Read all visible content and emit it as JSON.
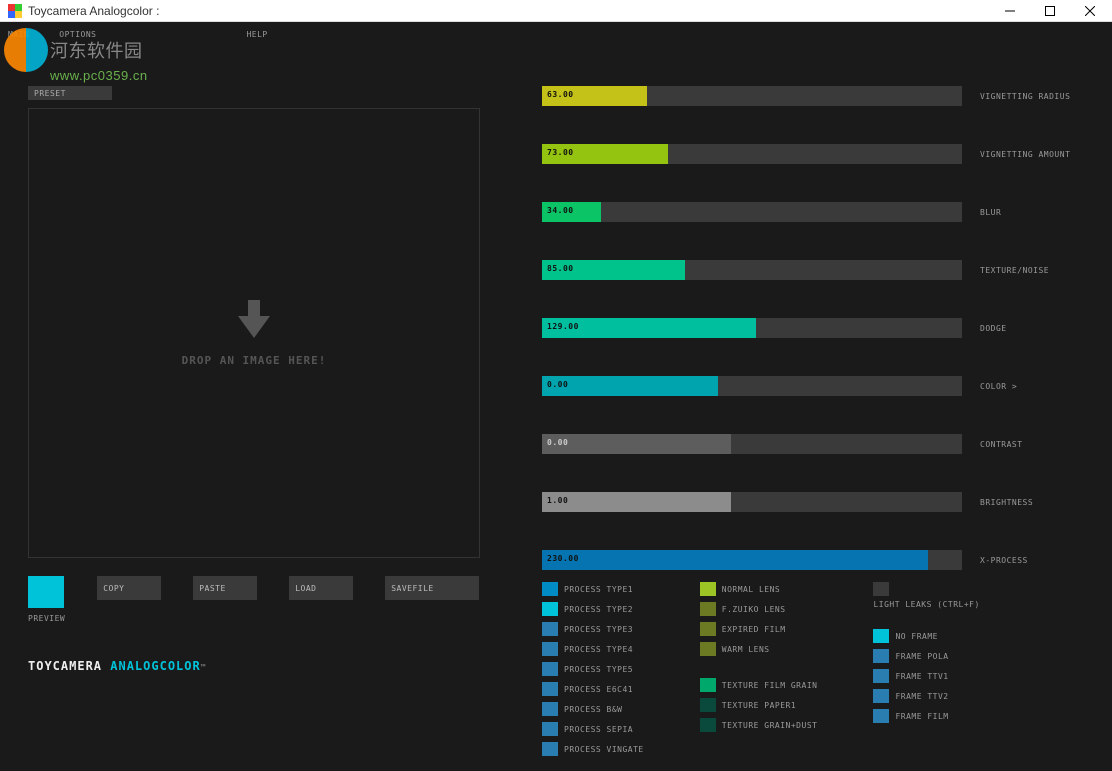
{
  "window": {
    "title": "Toycamera Analogcolor :"
  },
  "menubar": {
    "main": "MAIN",
    "options": "OPTIONS",
    "help": "HELP"
  },
  "watermark": {
    "cn": "河东软件园",
    "url": "www.pc0359.cn"
  },
  "preset_label": "PRESET",
  "dropzone": {
    "text": "DROP AN IMAGE HERE!"
  },
  "buttons": {
    "preview": "PREVIEW",
    "copy": "COPY",
    "paste": "PASTE",
    "load": "LOAD",
    "savefile": "SAVEFILE"
  },
  "brand": {
    "part1": "TOYCAMERA ",
    "part2": "ANALOGCOLOR",
    "tm": "™"
  },
  "sliders": [
    {
      "label": "VIGNETTING RADIUS",
      "value": "63.00",
      "pct": 25,
      "color": "#c4c219"
    },
    {
      "label": "VIGNETTING AMOUNT",
      "value": "73.00",
      "pct": 30,
      "color": "#94c410"
    },
    {
      "label": "BLUR",
      "value": "34.00",
      "pct": 14,
      "color": "#0bc466"
    },
    {
      "label": "TEXTURE/NOISE",
      "value": "85.00",
      "pct": 34,
      "color": "#00c38b"
    },
    {
      "label": "DODGE",
      "value": "129.00",
      "pct": 51,
      "color": "#00bf9f"
    },
    {
      "label": "COLOR >",
      "value": "0.00",
      "pct": 42,
      "color": "#00a4af"
    },
    {
      "label": "CONTRAST",
      "value": "0.00",
      "pct": 45,
      "color": "#5d5d5d",
      "light": true
    },
    {
      "label": "BRIGHTNESS",
      "value": "1.00",
      "pct": 45,
      "color": "#8c8c8c"
    },
    {
      "label": "X-PROCESS",
      "value": "230.00",
      "pct": 92,
      "color": "#0574b1"
    }
  ],
  "checks": {
    "col1": [
      {
        "color": "#008bc4",
        "label": "PROCESS TYPE1"
      },
      {
        "color": "#00c2d9",
        "label": "PROCESS TYPE2"
      },
      {
        "color": "#2a7db0",
        "label": "PROCESS TYPE3"
      },
      {
        "color": "#2a7db0",
        "label": "PROCESS TYPE4"
      },
      {
        "color": "#2a7db0",
        "label": "PROCESS TYPE5"
      },
      {
        "color": "#2a7db0",
        "label": "PROCESS E6C41"
      },
      {
        "color": "#2a7db0",
        "label": "PROCESS B&W"
      },
      {
        "color": "#2a7db0",
        "label": "PROCESS SEPIA"
      },
      {
        "color": "#2a7db0",
        "label": "PROCESS VINGATE"
      }
    ],
    "col2": [
      {
        "color": "#9cc424",
        "label": "NORMAL LENS"
      },
      {
        "color": "#6d7a24",
        "label": "F.ZUIKO LENS"
      },
      {
        "color": "#6d7a24",
        "label": "EXPIRED FILM"
      },
      {
        "color": "#6d7a24",
        "label": "WARM LENS"
      },
      {
        "spacer": true
      },
      {
        "color": "#00a86b",
        "label": "TEXTURE FILM GRAIN"
      },
      {
        "color": "#0a4a3c",
        "label": "TEXTURE PAPER1"
      },
      {
        "color": "#0a4a3c",
        "label": "TEXTURE GRAIN+DUST"
      }
    ],
    "col3": [
      {
        "color": "#3a3a3a",
        "label": ""
      },
      {
        "plain": "LIGHT LEAKS (CTRL+F)"
      },
      {
        "spacer": true
      },
      {
        "color": "#00c2d9",
        "label": "NO FRAME"
      },
      {
        "color": "#2a7db0",
        "label": "FRAME POLA"
      },
      {
        "color": "#2a7db0",
        "label": "FRAME TTV1"
      },
      {
        "color": "#2a7db0",
        "label": "FRAME TTV2"
      },
      {
        "color": "#2a7db0",
        "label": "FRAME FILM"
      }
    ]
  }
}
